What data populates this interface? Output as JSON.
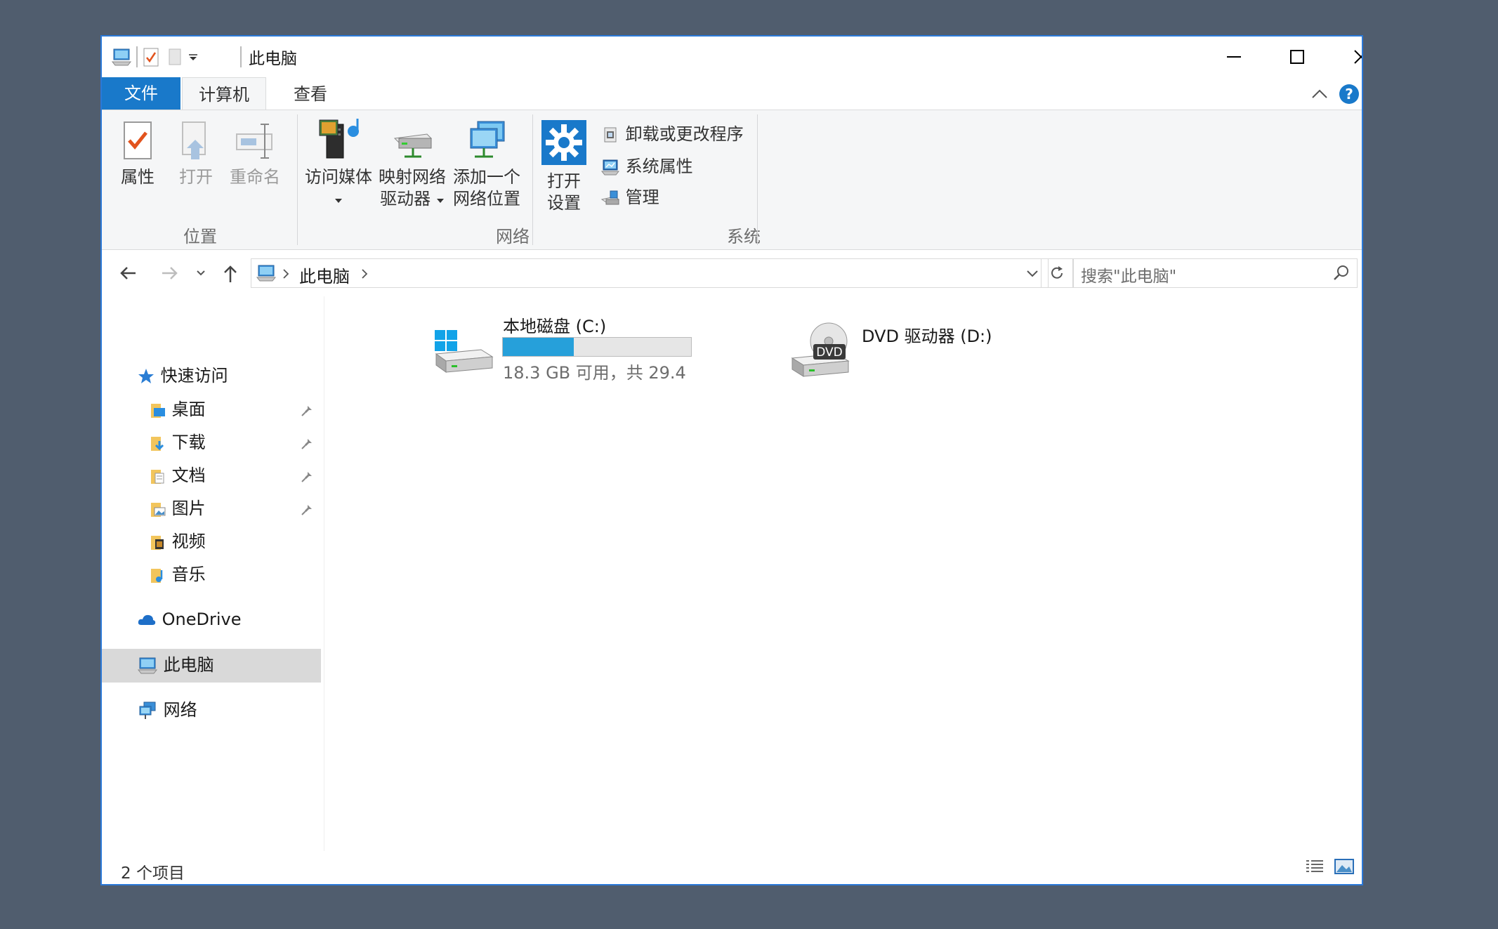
{
  "window": {
    "title": "此电脑",
    "quick_access_toolbar": [
      "computer-icon",
      "properties-check-icon",
      "new-folder-icon",
      "customize-dropdown-icon"
    ],
    "controls": [
      "minimize-icon",
      "maximize-icon",
      "close-icon"
    ]
  },
  "ribbon_tabs": {
    "file": "文件",
    "computer": "计算机",
    "view": "查看",
    "active": "计算机"
  },
  "ribbon": {
    "location": {
      "label": "位置",
      "properties": "属性",
      "open": "打开",
      "rename": "重命名"
    },
    "network": {
      "label": "网络",
      "access_media": "访问媒体",
      "map_drive_line1": "映射网络",
      "map_drive_line2": "驱动器",
      "add_location_line1": "添加一个",
      "add_location_line2": "网络位置"
    },
    "system": {
      "label": "系统",
      "open_settings_line1": "打开",
      "open_settings_line2": "设置",
      "uninstall": "卸载或更改程序",
      "system_properties": "系统属性",
      "manage": "管理"
    }
  },
  "address_bar": {
    "path": "此电脑",
    "search_placeholder": "搜索\"此电脑\""
  },
  "nav_pane": {
    "quick_access": "快速访问",
    "pinned": [
      {
        "label": "桌面",
        "pinned": true
      },
      {
        "label": "下载",
        "pinned": true
      },
      {
        "label": "文档",
        "pinned": true
      },
      {
        "label": "图片",
        "pinned": true
      },
      {
        "label": "视频",
        "pinned": false
      },
      {
        "label": "音乐",
        "pinned": false
      }
    ],
    "onedrive": "OneDrive",
    "this_pc": "此电脑",
    "network": "网络",
    "selected": "此电脑"
  },
  "drives": [
    {
      "name": "本地磁盘 (C:)",
      "free_text": "18.3 GB 可用，共 29.4",
      "used_fraction": 0.377,
      "icon": "windows-drive-icon"
    },
    {
      "name": "DVD 驱动器 (D:)",
      "icon": "dvd-drive-icon",
      "icon_text": "DVD"
    }
  ],
  "status_bar": {
    "item_count": "2 个项目",
    "views": [
      "details-view-icon",
      "large-icons-view-icon"
    ]
  },
  "colors": {
    "accent": "#1979ca",
    "window_border": "#2b79d8",
    "desktop": "#505d6e",
    "usage_bar": "#26a0da",
    "selection": "#d9d9d9"
  }
}
